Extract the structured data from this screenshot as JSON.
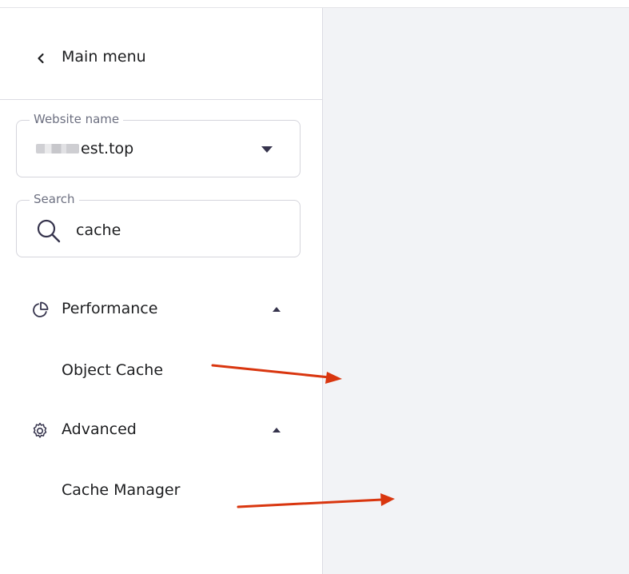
{
  "sidebar": {
    "back_label": "Main menu",
    "website_field": {
      "legend": "Website name",
      "value": "est.top"
    },
    "search_field": {
      "legend": "Search",
      "value": "cache"
    },
    "groups": [
      {
        "label": "Performance",
        "icon": "pie-chart-icon",
        "expanded": true,
        "items": [
          {
            "label": "Object Cache"
          }
        ]
      },
      {
        "label": "Advanced",
        "icon": "gear-icon",
        "expanded": true,
        "items": [
          {
            "label": "Cache Manager"
          }
        ]
      }
    ]
  },
  "colors": {
    "main_background": "#f2f3f6",
    "annotation_arrow": "#d9360f",
    "text": "#1d1e20"
  }
}
